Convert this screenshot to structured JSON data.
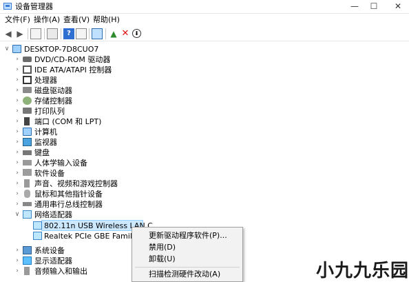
{
  "window": {
    "title": "设备管理器",
    "controls": {
      "minimize": "—",
      "maximize": "☐",
      "close": "✕"
    }
  },
  "menu": {
    "items": [
      "文件(F)",
      "操作(A)",
      "查看(V)",
      "帮助(H)"
    ]
  },
  "toolbar": {
    "icons": [
      "back-arrow-icon",
      "forward-arrow-icon",
      "properties-icon",
      "show-hide-icon",
      "help-icon",
      "details-icon",
      "monitor-icon",
      "update-driver-icon",
      "uninstall-icon",
      "enable-device-icon"
    ]
  },
  "tree": {
    "root": "DESKTOP-7D8CUO7",
    "categories": [
      "DVD/CD-ROM 驱动器",
      "IDE ATA/ATAPI 控制器",
      "处理器",
      "磁盘驱动器",
      "存储控制器",
      "打印队列",
      "端口 (COM 和 LPT)",
      "计算机",
      "监视器",
      "键盘",
      "人体学输入设备",
      "软件设备",
      "声音、视频和游戏控制器",
      "鼠标和其他指针设备",
      "通用串行总线控制器",
      "网络适配器"
    ],
    "network_children": [
      "802.11n USB Wireless LAN C",
      "Realtek PCIe GBE Family Co"
    ],
    "after": [
      "系统设备",
      "显示适配器",
      "音频输入和输出"
    ]
  },
  "context_menu": {
    "items": [
      "更新驱动程序软件(P)...",
      "禁用(D)",
      "卸载(U)",
      "扫描检测硬件改动(A)"
    ]
  },
  "watermark": "小九九乐园"
}
